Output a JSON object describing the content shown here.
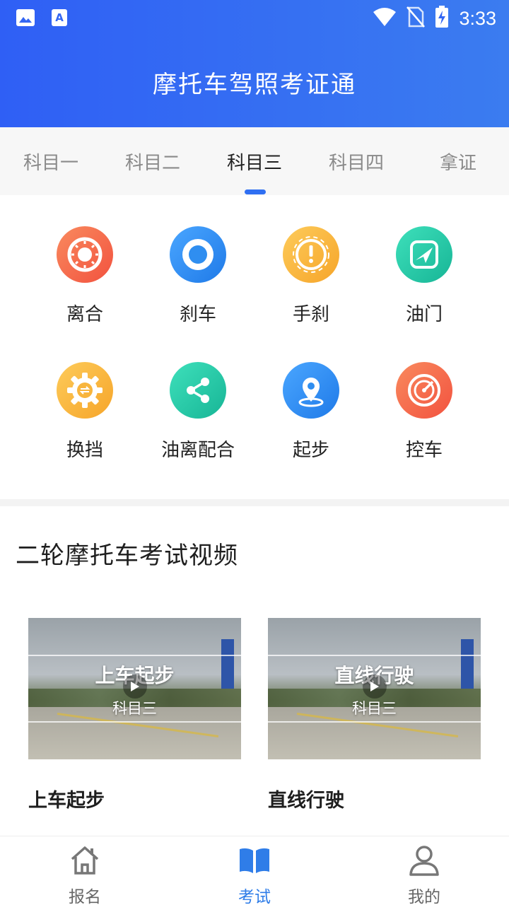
{
  "status_bar": {
    "time": "3:33",
    "left_icons": [
      "image-icon",
      "text-a-icon"
    ],
    "right_icons": [
      "wifi-icon",
      "no-sim-icon",
      "battery-charging-icon"
    ]
  },
  "header": {
    "title": "摩托车驾照考证通",
    "color": "#3366f3"
  },
  "tabs": [
    {
      "label": "科目一",
      "active": false
    },
    {
      "label": "科目二",
      "active": false
    },
    {
      "label": "科目三",
      "active": true
    },
    {
      "label": "科目四",
      "active": false
    },
    {
      "label": "拿证",
      "active": false
    }
  ],
  "features": [
    {
      "label": "离合",
      "icon": "sun-icon",
      "color": "#f46a4e"
    },
    {
      "label": "刹车",
      "icon": "ring-icon",
      "color": "#2f8ef0"
    },
    {
      "label": "手刹",
      "icon": "alert-icon",
      "color": "#f8b53d"
    },
    {
      "label": "油门",
      "icon": "plane-icon",
      "color": "#27c9a8"
    },
    {
      "label": "换挡",
      "icon": "gear-icon",
      "color": "#f8b53d"
    },
    {
      "label": "油离配合",
      "icon": "share-icon",
      "color": "#27c9a8"
    },
    {
      "label": "起步",
      "icon": "location-icon",
      "color": "#2f8ef0"
    },
    {
      "label": "控车",
      "icon": "gauge-icon",
      "color": "#f46a4e"
    }
  ],
  "section": {
    "title": "二轮摩托车考试视频"
  },
  "videos": [
    {
      "overlay_title": "上车起步",
      "overlay_subtitle": "科目三",
      "title": "上车起步"
    },
    {
      "overlay_title": "直线行驶",
      "overlay_subtitle": "科目三",
      "title": "直线行驶"
    }
  ],
  "bottom_nav": [
    {
      "label": "报名",
      "icon": "home-icon",
      "active": false
    },
    {
      "label": "考试",
      "icon": "book-icon",
      "active": true
    },
    {
      "label": "我的",
      "icon": "user-icon",
      "active": false
    }
  ],
  "accent_color": "#2f7de8"
}
